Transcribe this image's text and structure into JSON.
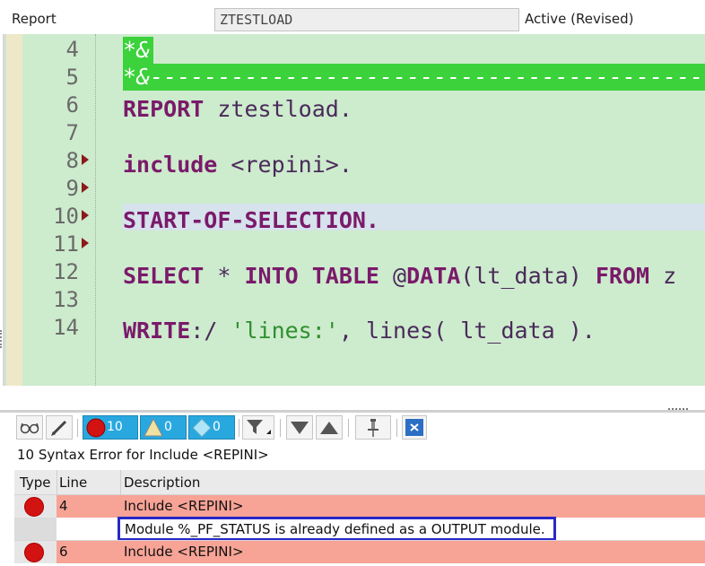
{
  "header": {
    "object_type": "Report",
    "program_name": "ZTESTLOAD",
    "status": "Active (Revised)"
  },
  "editor": {
    "lines": [
      {
        "num": "4",
        "text": "*&"
      },
      {
        "num": "5",
        "text": "*&---------------------------------------------"
      },
      {
        "num": "6",
        "text": ""
      },
      {
        "num": "7",
        "text": ""
      },
      {
        "num": "8",
        "text": ""
      },
      {
        "num": "9",
        "text": ""
      },
      {
        "num": "10",
        "text": ""
      },
      {
        "num": "11",
        "text": ""
      },
      {
        "num": "12",
        "text": ""
      },
      {
        "num": "13",
        "text": ""
      },
      {
        "num": "14",
        "text": ""
      }
    ],
    "code": {
      "l6_kw": "REPORT",
      "l6_rest": " ztestload.",
      "l8_kw": "include",
      "l8_rest": " <repini>.",
      "l10": "START-OF-SELECTION.",
      "l12_kw1": "SELECT",
      "l12_op": " * ",
      "l12_kw2": "INTO TABLE",
      "l12_at": " @",
      "l12_kw3": "DATA",
      "l12_var": "(lt_data) ",
      "l12_kw4": "FROM",
      "l12_tail": " z",
      "l14_kw": "WRITE",
      "l14_op": ":/ ",
      "l14_str": "'lines:'",
      "l14_rest": ", lines( lt_data )."
    },
    "error_marker_lines": [
      "8",
      "9",
      "10",
      "11"
    ]
  },
  "toolbar": {
    "errors_count": "10",
    "warnings_count": "0",
    "info_count": "0",
    "icons": [
      "glasses-icon",
      "pencil-icon",
      "error-filter-icon",
      "warning-filter-icon",
      "info-filter-icon",
      "filter-icon",
      "sort-desc-icon",
      "sort-asc-icon",
      "pin-icon",
      "close-icon"
    ]
  },
  "messages": {
    "title": "10 Syntax Error for Include <REPINI>",
    "columns": [
      "Type",
      "Line",
      "Description"
    ],
    "rows": [
      {
        "type": "error",
        "line": "4",
        "description": "Include <REPINI>"
      },
      {
        "type": "detail",
        "line": "",
        "description": "Module %_PF_STATUS is already defined as a OUTPUT module."
      },
      {
        "type": "error",
        "line": "6",
        "description": "Include <REPINI>"
      }
    ]
  },
  "colors": {
    "editor_bg": "#cdebcd",
    "comment_band": "#3bd23b",
    "error_row": "#f7a396",
    "toolbar_blue": "#29a8e0",
    "detail_frame": "#2828c8",
    "error_dot": "#d31212"
  }
}
